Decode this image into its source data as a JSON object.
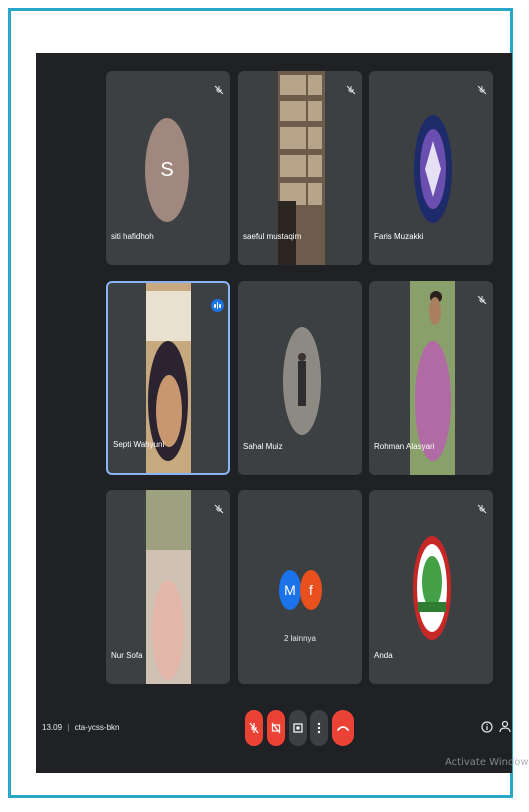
{
  "participants": [
    {
      "name": "siti hafidhoh",
      "avatar_letter": "S",
      "avatar_color": "#a1887f",
      "muted": true
    },
    {
      "name": "saeful mustaqim",
      "muted": true
    },
    {
      "name": "Faris Muzakki",
      "muted": true
    },
    {
      "name": "Septi Wahyuni",
      "speaking": true
    },
    {
      "name": "Sahal Muiz"
    },
    {
      "name": "Rohman Alasyari",
      "muted": true
    },
    {
      "name": "Nur Sofa",
      "muted": true
    },
    {
      "name": "2 lainnya",
      "avatars": [
        "M",
        "f"
      ],
      "avatar_colors": [
        "#1a73e8",
        "#e8501d"
      ]
    },
    {
      "name": "Anda",
      "muted": true
    }
  ],
  "meeting": {
    "time": "13.09",
    "code": "cta-ycss-bkn"
  },
  "controls": [
    "mic-off-icon",
    "camera-off-icon",
    "present-icon",
    "more-options-icon",
    "hang-up-icon"
  ],
  "watermark": "Activate Windows",
  "colors": {
    "accent": "#1a73e8",
    "danger": "#ea4335",
    "tile": "#3c4043",
    "background": "#202124",
    "frame": "#27a7c9"
  }
}
